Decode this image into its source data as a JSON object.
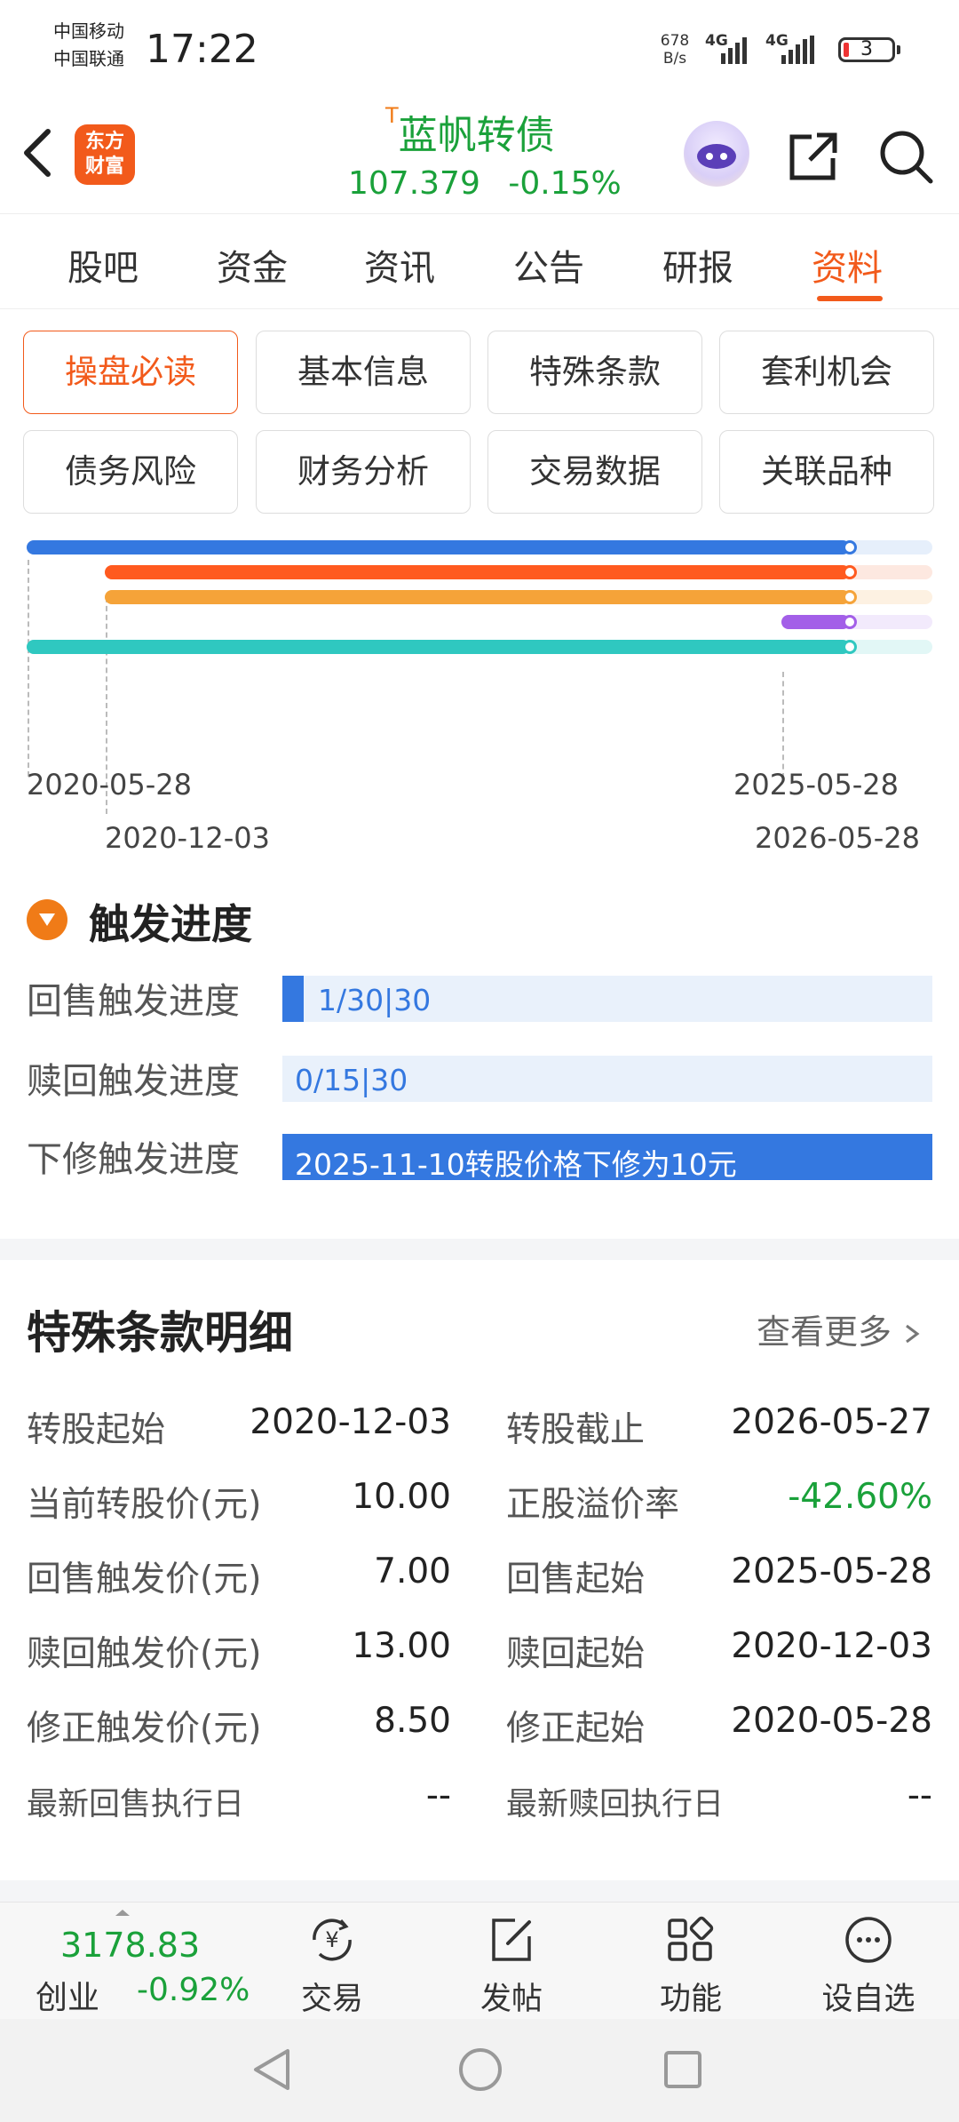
{
  "status_bar": {
    "carrier1": "中国移动",
    "carrier2": "中国联通",
    "time": "17:22",
    "net_speed_value": "678",
    "net_speed_unit": "B/s",
    "signal1": "4G",
    "signal2": "4G",
    "battery": "3"
  },
  "header": {
    "logo_line1": "东方",
    "logo_line2": "财富",
    "title_prefix": "T",
    "title": "蓝帆转债",
    "price": "107.379",
    "change": "-0.15%"
  },
  "tabs": [
    "股吧",
    "资金",
    "资讯",
    "公告",
    "研报",
    "资料"
  ],
  "active_tab": 5,
  "grid_buttons": [
    "操盘必读",
    "基本信息",
    "特殊条款",
    "套利机会",
    "债务风险",
    "财务分析",
    "交易数据",
    "关联品种"
  ],
  "active_grid_button": 0,
  "timeline": {
    "bars": [
      {
        "start": "2020-05-28",
        "end": "2026-05-28",
        "color": "#3478e0",
        "light": "#e6effb"
      },
      {
        "start": "2020-12-03",
        "end": "2026-05-28",
        "color": "#ff5a1f",
        "light": "#fde8e0"
      },
      {
        "start": "2020-12-03",
        "end": "2026-05-28",
        "color": "#f5a339",
        "light": "#fdf1e2"
      },
      {
        "start": "2025-05-28",
        "end": "2026-05-28",
        "color": "#a35fe8",
        "light": "#f2eafc"
      },
      {
        "start": "2020-05-28",
        "end": "2026-05-28",
        "color": "#2fc8c0",
        "light": "#e2f7f6"
      }
    ],
    "current_date": "2025-11-10",
    "date_labels": {
      "left_top": "2020-05-28",
      "left_bottom": "2020-12-03",
      "right_top": "2025-05-28",
      "right_bottom": "2026-05-28"
    }
  },
  "trigger": {
    "title": "触发进度",
    "rows": [
      {
        "label": "回售触发进度",
        "text": "1/30|30",
        "progress": 0.0333
      },
      {
        "label": "赎回触发进度",
        "text": "0/15|30",
        "progress": 0
      },
      {
        "label": "下修触发进度",
        "text": "2025-11-10转股价格下修为10元",
        "progress": 1
      }
    ]
  },
  "detail": {
    "title": "特殊条款明细",
    "more": "查看更多",
    "rows": [
      {
        "k1": "转股起始",
        "v1": "2020-12-03",
        "k2": "转股截止",
        "v2": "2026-05-27"
      },
      {
        "k1": "当前转股价(元)",
        "v1": "10.00",
        "k2": "正股溢价率",
        "v2": "-42.60%"
      },
      {
        "k1": "回售触发价(元)",
        "v1": "7.00",
        "k2": "回售起始",
        "v2": "2025-05-28"
      },
      {
        "k1": "赎回触发价(元)",
        "v1": "13.00",
        "k2": "赎回起始",
        "v2": "2020-12-03"
      },
      {
        "k1": "修正触发价(元)",
        "v1": "8.50",
        "k2": "修正起始",
        "v2": "2020-05-28"
      },
      {
        "k1": "最新回售执行日",
        "v1": "--",
        "k2": "最新赎回执行日",
        "v2": "--"
      }
    ],
    "negative_color": "#1aa13a"
  },
  "bottom_nav": {
    "index_value": "3178.83",
    "index_name": "创业",
    "index_change": "-0.92%",
    "items": [
      "交易",
      "发帖",
      "功能",
      "设自选"
    ]
  }
}
